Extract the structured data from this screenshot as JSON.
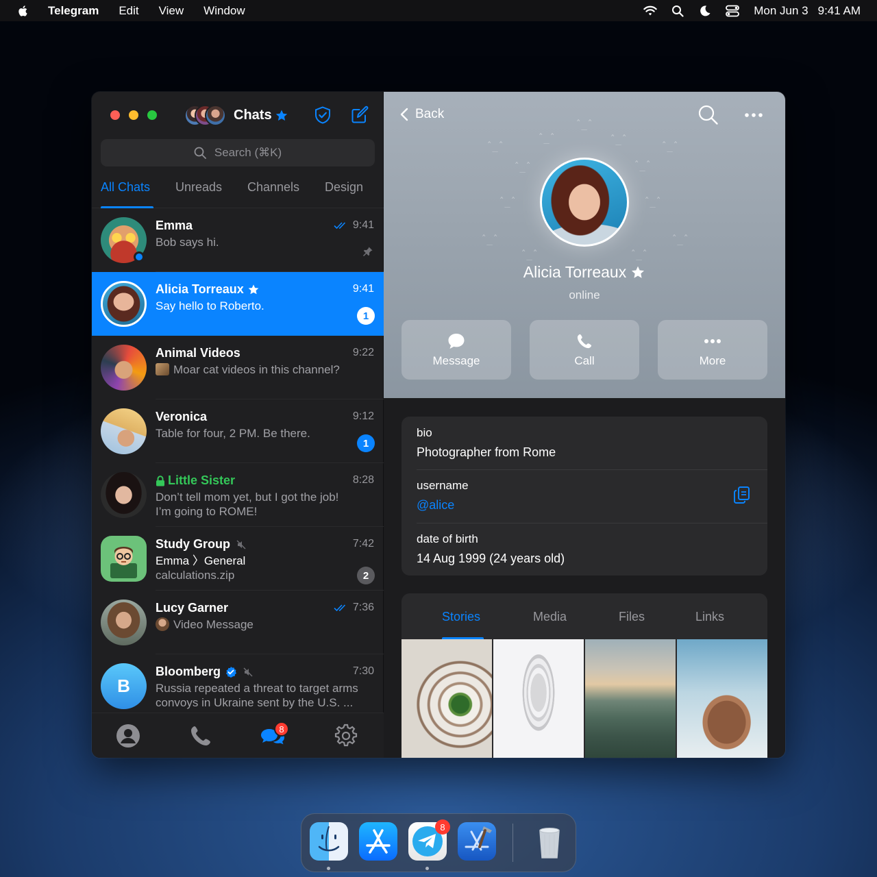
{
  "menubar": {
    "app_name": "Telegram",
    "menus": [
      "Edit",
      "View",
      "Window"
    ],
    "date": "Mon Jun 3",
    "time": "9:41 AM"
  },
  "sidebar": {
    "title": "Chats",
    "search_placeholder": "Search (⌘K)",
    "tabs": [
      {
        "label": "All Chats",
        "active": true
      },
      {
        "label": "Unreads"
      },
      {
        "label": "Channels"
      },
      {
        "label": "Design"
      }
    ],
    "chats": [
      {
        "name": "Emma",
        "time": "9:41",
        "message": "Bob says hi.",
        "read": true,
        "pinned": true,
        "online": true
      },
      {
        "name": "Alicia Torreaux",
        "time": "9:41",
        "message": "Say hello to Roberto.",
        "unread": "1",
        "selected": true,
        "premium": true
      },
      {
        "name": "Animal Videos",
        "time": "9:22",
        "message": "Moar cat videos in this channel?"
      },
      {
        "name": "Veronica",
        "time": "9:12",
        "message": "Table for four, 2 PM. Be there.",
        "unread": "1"
      },
      {
        "name": "Little Sister",
        "time": "8:28",
        "message_line1": "Don’t tell mom yet, but I got the job!",
        "message_line2": "I’m going to ROME!",
        "secret": true
      },
      {
        "name": "Study Group",
        "time": "7:42",
        "message_sender": "Emma",
        "message_topic": "General",
        "message": "calculations.zip",
        "unread": "2",
        "muted": true
      },
      {
        "name": "Lucy Garner",
        "time": "7:36",
        "message": "Video Message",
        "read": true
      },
      {
        "name": "Bloomberg",
        "time": "7:30",
        "message_line1": "Russia repeated a threat to target arms",
        "message_line2": "convoys in Ukraine sent by the U.S. ...",
        "verified": true,
        "muted": true,
        "avatar_letter": "B"
      }
    ],
    "bottom_badge": "8"
  },
  "profile": {
    "back_label": "Back",
    "name": "Alicia Torreaux",
    "status": "online",
    "actions": [
      "Message",
      "Call",
      "More"
    ],
    "bio_label": "bio",
    "bio": "Photographer from Rome",
    "username_label": "username",
    "username": "@alice",
    "dob_label": "date of birth",
    "dob": "14 Aug 1999 (24 years old)",
    "media_tabs": [
      {
        "label": "Stories",
        "active": true
      },
      {
        "label": "Media"
      },
      {
        "label": "Files"
      },
      {
        "label": "Links"
      }
    ]
  },
  "dock": {
    "telegram_badge": "8"
  },
  "colors": {
    "accent": "#0a84ff",
    "secret_chat": "#34c759"
  }
}
